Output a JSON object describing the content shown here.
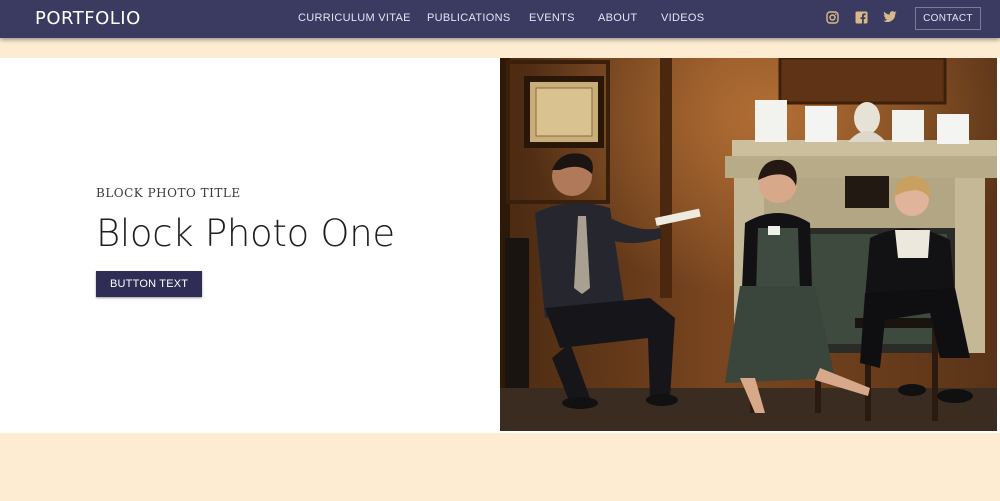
{
  "header": {
    "brand": "PORTFOLIO",
    "nav": [
      {
        "label": "CURRICULUM VITAE"
      },
      {
        "label": "PUBLICATIONS"
      },
      {
        "label": "EVENTS"
      },
      {
        "label": "ABOUT"
      },
      {
        "label": "VIDEOS"
      }
    ],
    "social_icons": [
      "instagram-icon",
      "facebook-icon",
      "twitter-icon"
    ],
    "contact_label": "CONTACT"
  },
  "block": {
    "eyebrow": "BLOCK PHOTO TITLE",
    "title": "Block Photo One",
    "button_label": "BUTTON TEXT"
  },
  "colors": {
    "nav_background": "#3b3a60",
    "page_background": "#fdebd2",
    "button_background": "#2f2d55"
  }
}
